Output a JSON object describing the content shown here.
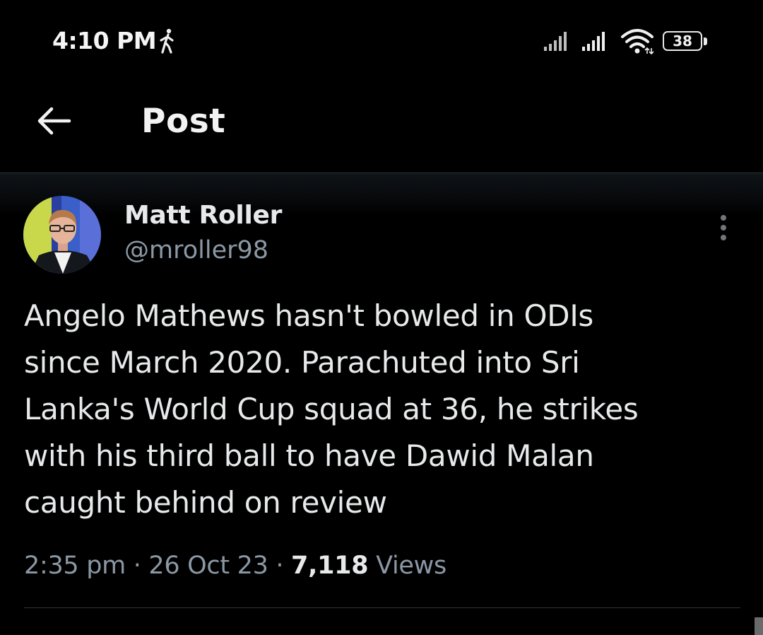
{
  "status_bar": {
    "time": "4:10 PM",
    "battery_level": "38",
    "icons": [
      "walking-icon",
      "signal-icon",
      "signal-icon",
      "wifi-icon",
      "battery-icon"
    ]
  },
  "header": {
    "back_icon": "arrow-left-icon",
    "title": "Post"
  },
  "post": {
    "author_name": "Matt Roller",
    "author_handle": "@mroller98",
    "more_icon": "more-vertical-icon",
    "text": "Angelo Mathews hasn't bowled in ODIs\nsince March 2020. Parachuted into Sri\nLanka's World Cup squad at 36, he strikes\nwith his third ball to have Dawid Malan\ncaught behind on review",
    "time": "2:35 pm",
    "separator": "·",
    "date": "26 Oct 23",
    "views_count": "7,118",
    "views_label": "Views"
  },
  "colors": {
    "background": "#000000",
    "text_primary": "#e7e9ea",
    "text_secondary": "#8b98a5",
    "divider": "#2f3336"
  }
}
